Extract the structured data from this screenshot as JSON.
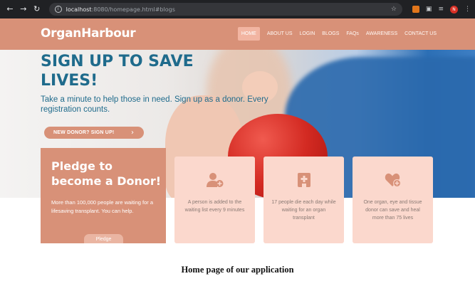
{
  "browser": {
    "host": "localhost",
    "path": ":8080/homepage.html#blogs"
  },
  "site": {
    "brand": "OrganHarbour",
    "menu": [
      "HOME",
      "ABOUT US",
      "LOGIN",
      "BLOGS",
      "FAQs",
      "AWARENESS",
      "CONTACT US"
    ],
    "active_menu": "HOME"
  },
  "hero": {
    "title": "SIGN UP TO SAVE LIVES!",
    "subtitle": "Take a minute to help those in need. Sign up as a donor. Every registration counts.",
    "cta": "NEW DONOR? SIGN UP!"
  },
  "pledge": {
    "title": "Pledge to become a Donor!",
    "text": "More than 100,000 people are waiting for a lifesaving transplant. You can help.",
    "button": "Pledge"
  },
  "cards": [
    {
      "icon": "add-user-icon",
      "text": "A person is added to the waiting list every 9 minutes"
    },
    {
      "icon": "hospital-icon",
      "text": "17 people die each day while waiting for an organ transplant"
    },
    {
      "icon": "heart-plus-icon",
      "text": "One organ, eye and tissue donor can save and heal more than 75 lives"
    }
  ],
  "caption": "Home page of our application",
  "colors": {
    "accent": "#d89178",
    "card_bg": "#fbd8cd",
    "heading": "#1f6b8c"
  }
}
